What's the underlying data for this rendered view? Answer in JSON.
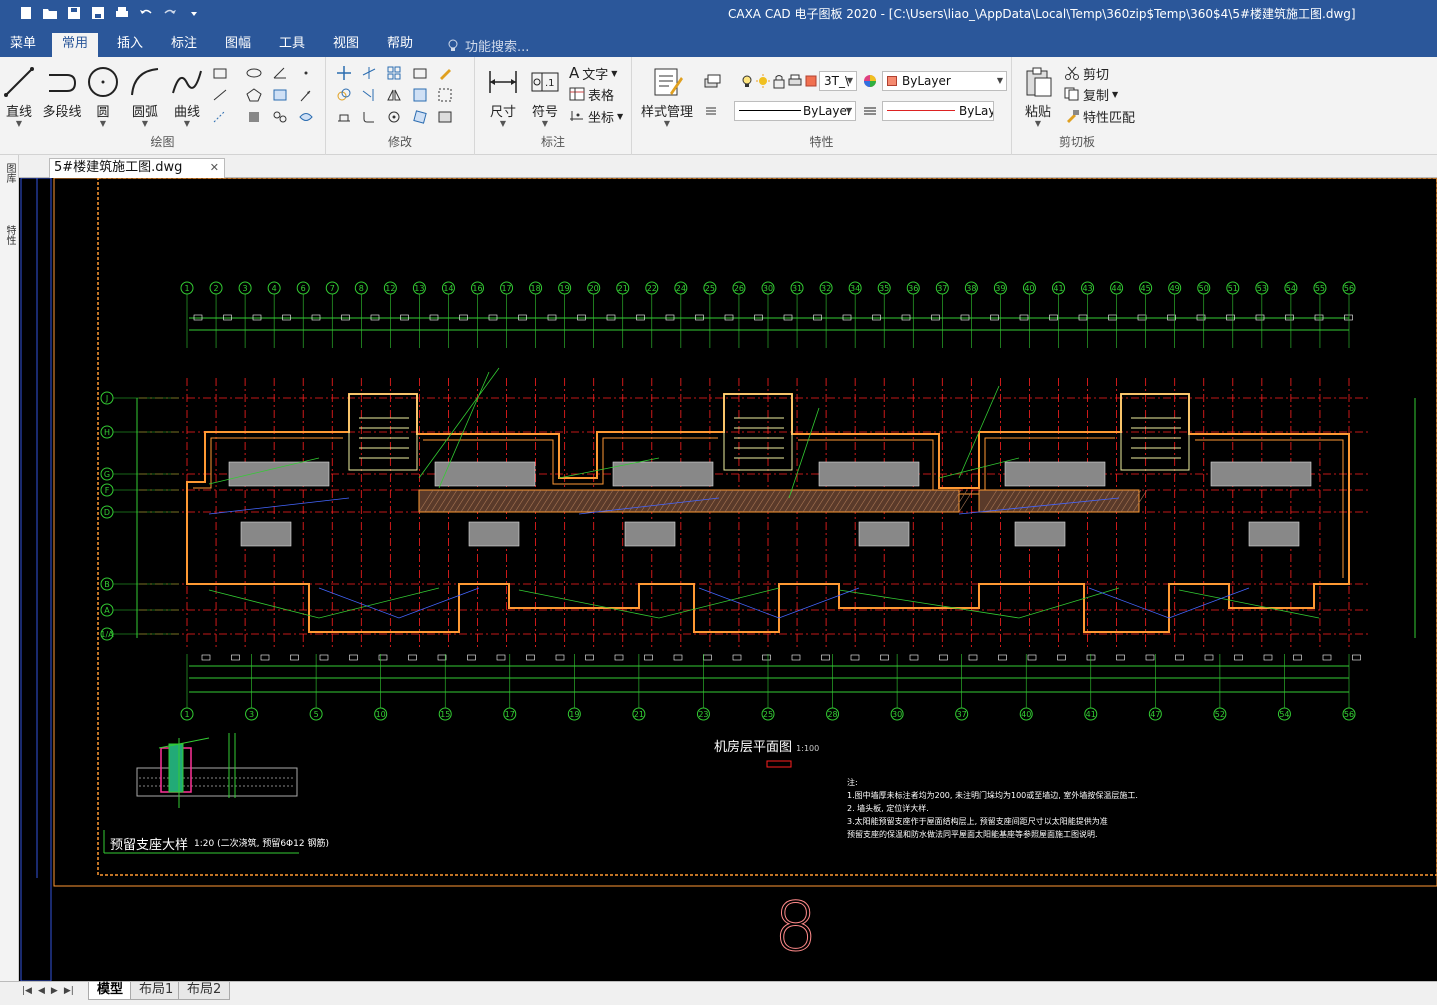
{
  "window": {
    "title": "CAXA CAD 电子图板 2020 - [C:\\Users\\liao_\\AppData\\Local\\Temp\\360zip$Temp\\360$4\\5#楼建筑施工图.dwg]"
  },
  "ribbon_tabs": [
    {
      "label": "菜单"
    },
    {
      "label": "常用"
    },
    {
      "label": "插入"
    },
    {
      "label": "标注"
    },
    {
      "label": "图幅"
    },
    {
      "label": "工具"
    },
    {
      "label": "视图"
    },
    {
      "label": "帮助"
    }
  ],
  "search": {
    "placeholder": "功能搜索..."
  },
  "groups": {
    "draw": {
      "label": "绘图",
      "buttons": [
        "直线",
        "多段线",
        "圆",
        "圆弧",
        "曲线"
      ]
    },
    "modify": {
      "label": "修改"
    },
    "annotate": {
      "label": "标注",
      "buttons": [
        "尺寸",
        "符号"
      ],
      "small": [
        "文字",
        "表格",
        "坐标"
      ]
    },
    "properties": {
      "label": "特性",
      "style_button": "样式管理",
      "layer": "3T_\\",
      "color": "ByLayer",
      "linetype": "ByLayer",
      "lineweight": "ByLay"
    },
    "clipboard": {
      "label": "剪切板",
      "paste": "粘贴",
      "small": [
        "剪切",
        "复制",
        "特性匹配"
      ]
    }
  },
  "left_palette": {
    "items": [
      "图库",
      "特性"
    ]
  },
  "document_tab": {
    "label": "5#楼建筑施工图.dwg"
  },
  "drawing": {
    "plan_title": "机房层平面图",
    "plan_scale": "1:100",
    "detail_title": "预留支座大样",
    "detail_scale": "1:20",
    "detail_note": "(二次浇筑, 预留6Φ12 钢筋)",
    "notes_heading": "注:",
    "notes": [
      "1.图中墙厚未标注者均为200, 未注明门垛均为100或至墙边, 室外墙按保温层施工.",
      "2.       墙头板, 定位详大样.",
      "3.太阳能预留支座作于屋面结构层上, 预留支座间距尺寸以太阳能提供为准",
      "   预留支座的保温和防水做法同平屋面太阳能基座等参照屋面施工图说明."
    ],
    "sheet_number": "8",
    "top_axes": [
      "1",
      "2",
      "3",
      "4",
      "6",
      "7",
      "8",
      "12",
      "13",
      "14",
      "16",
      "17",
      "18",
      "19",
      "20",
      "21",
      "22",
      "24",
      "25",
      "26",
      "30",
      "31",
      "32",
      "34",
      "35",
      "36",
      "37",
      "38",
      "39",
      "40",
      "41",
      "43",
      "44",
      "45",
      "49",
      "50",
      "51",
      "53",
      "54",
      "55",
      "56"
    ],
    "bottom_axes": [
      "1",
      "3",
      "5",
      "10",
      "15",
      "17",
      "19",
      "21",
      "23",
      "25",
      "28",
      "30",
      "37",
      "40",
      "41",
      "47",
      "52",
      "54",
      "56"
    ],
    "left_axes": [
      "J",
      "H",
      "G",
      "F",
      "D",
      "B",
      "A",
      "1/A"
    ]
  },
  "layout_tabs": [
    {
      "label": "模型"
    },
    {
      "label": "布局1"
    },
    {
      "label": "布局2"
    }
  ],
  "colors": {
    "titlebar": "#2b579a",
    "canvas": "#000000",
    "axis": "#33cc33",
    "wall": "#ff9933",
    "grid_red": "#ff2020"
  }
}
